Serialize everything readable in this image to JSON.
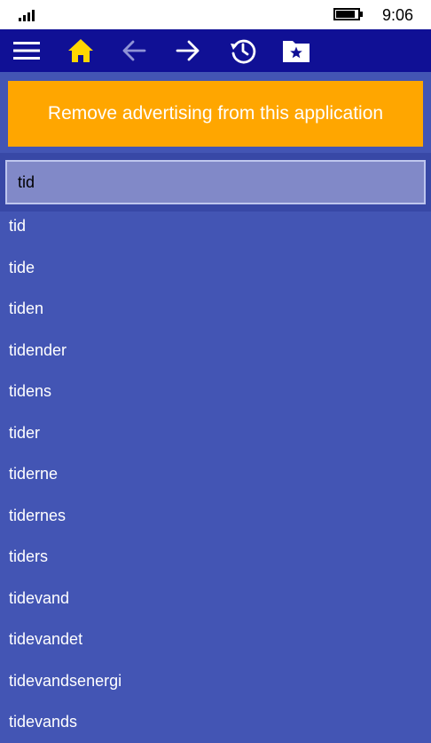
{
  "status_bar": {
    "time": "9:06",
    "signal_icon": "signal-bars-icon",
    "battery_icon": "battery-icon"
  },
  "toolbar": {
    "buttons": [
      {
        "name": "menu",
        "icon": "hamburger-menu-icon"
      },
      {
        "name": "home",
        "icon": "home-icon"
      },
      {
        "name": "back",
        "icon": "arrow-left-icon"
      },
      {
        "name": "forward",
        "icon": "arrow-right-icon"
      },
      {
        "name": "history",
        "icon": "history-icon"
      },
      {
        "name": "favorites",
        "icon": "star-folder-icon"
      }
    ]
  },
  "ad_banner": {
    "label": "Remove advertising from this application"
  },
  "search": {
    "value": "tid"
  },
  "results": [
    "tid",
    "tide",
    "tiden",
    "tidender",
    "tidens",
    "tider",
    "tiderne",
    "tidernes",
    "tiders",
    "tidevand",
    "tidevandet",
    "tidevandsenergi",
    "tidevands"
  ],
  "colors": {
    "status_bar": "#FFFFFF",
    "app_bar": "#101095",
    "accent_home": "#FFD700",
    "ad_banner": "#FFA600",
    "page_background": "#4355B4",
    "search_field": "#8189C8"
  }
}
